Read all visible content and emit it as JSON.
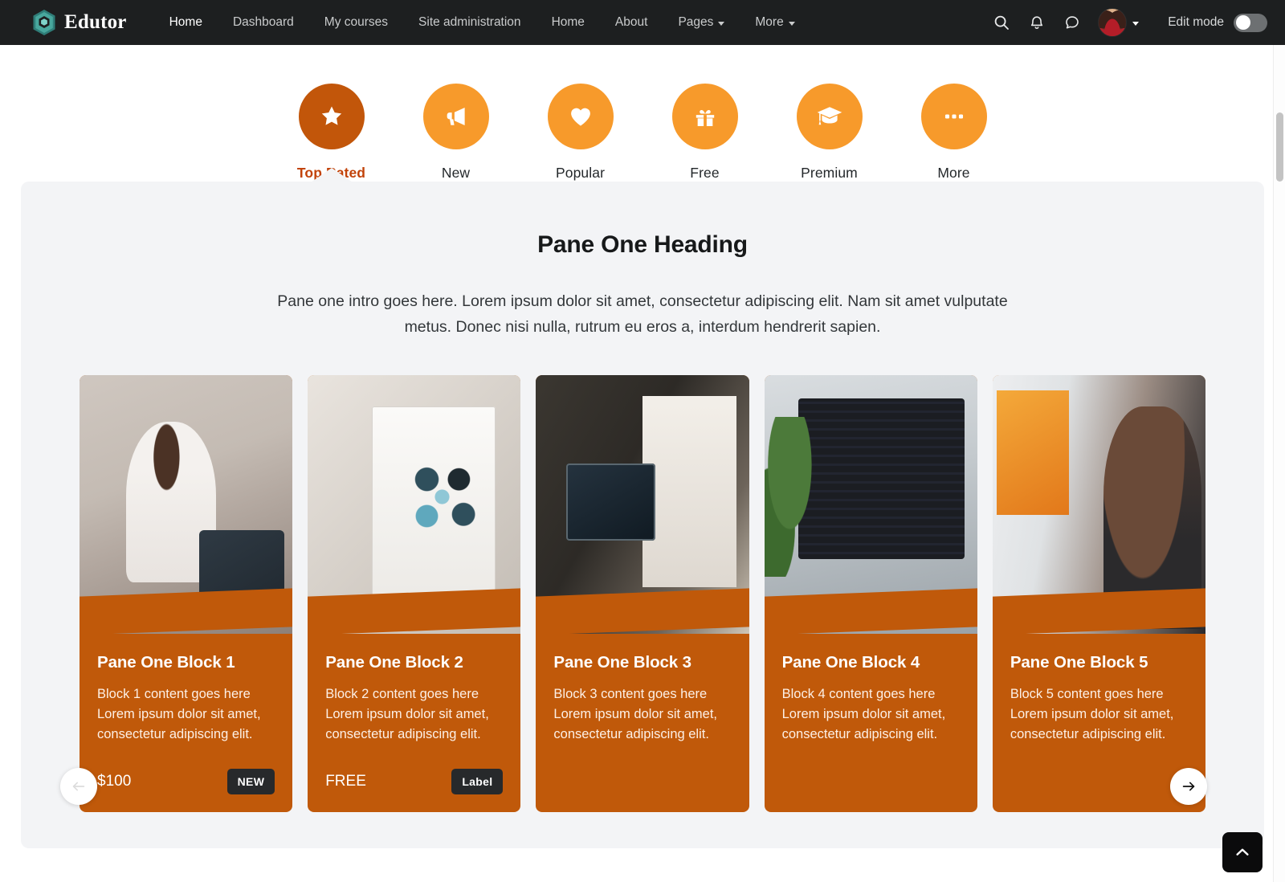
{
  "navbar": {
    "brand": {
      "name": "Edutor",
      "icon": "hexagon-cube-logo-icon"
    },
    "links": [
      {
        "label": "Home",
        "active": true,
        "caret": false
      },
      {
        "label": "Dashboard",
        "active": false,
        "caret": false
      },
      {
        "label": "My courses",
        "active": false,
        "caret": false
      },
      {
        "label": "Site administration",
        "active": false,
        "caret": false
      },
      {
        "label": "Home",
        "active": false,
        "caret": false
      },
      {
        "label": "About",
        "active": false,
        "caret": false
      },
      {
        "label": "Pages",
        "active": false,
        "caret": true
      },
      {
        "label": "More",
        "active": false,
        "caret": true
      }
    ],
    "icons": [
      {
        "name": "search-icon"
      },
      {
        "name": "bell-notification-icon"
      },
      {
        "name": "message-bubble-icon"
      }
    ],
    "avatar": {
      "name": "user-avatar",
      "caret": true
    },
    "edit_mode": {
      "label": "Edit mode",
      "enabled": false
    }
  },
  "categories": [
    {
      "label": "Top Rated",
      "icon": "star-icon",
      "active": true
    },
    {
      "label": "New",
      "icon": "megaphone-icon",
      "active": false
    },
    {
      "label": "Popular",
      "icon": "heart-icon",
      "active": false
    },
    {
      "label": "Free",
      "icon": "gift-icon",
      "active": false
    },
    {
      "label": "Premium",
      "icon": "graduation-cap-icon",
      "active": false
    },
    {
      "label": "More",
      "icon": "ellipsis-icon",
      "active": false
    }
  ],
  "pane": {
    "heading": "Pane One Heading",
    "intro": "Pane one intro goes here. Lorem ipsum dolor sit amet, consectetur adipiscing elit. Nam sit amet vulputate metus. Donec nisi nulla, rutrum eu eros a, interdum hendrerit sapien."
  },
  "cards": [
    {
      "title": "Pane One Block 1",
      "text": "Block 1 content goes here Lorem ipsum dolor sit amet, consectetur adipiscing elit.",
      "price": "$100",
      "badge": "NEW",
      "image_alt": "woman-reading-tablet-on-couch"
    },
    {
      "title": "Pane One Block 2",
      "text": "Block 2 content goes here Lorem ipsum dolor sit amet, consectetur adipiscing elit.",
      "price": "FREE",
      "badge": "Label",
      "image_alt": "open-book-with-diagram"
    },
    {
      "title": "Pane One Block 3",
      "text": "Block 3 content goes here Lorem ipsum dolor sit amet, consectetur adipiscing elit.",
      "price": "",
      "badge": "",
      "image_alt": "man-holding-tablet-by-easel"
    },
    {
      "title": "Pane One Block 4",
      "text": "Block 4 content goes here Lorem ipsum dolor sit amet, consectetur adipiscing elit.",
      "price": "",
      "badge": "",
      "image_alt": "hands-typing-on-laptop-with-code"
    },
    {
      "title": "Pane One Block 5",
      "text": "Block 5 content goes here Lorem ipsum dolor sit amet, consectetur adipiscing elit.",
      "price": "",
      "badge": "",
      "image_alt": "woman-with-sticky-notes-at-window"
    }
  ],
  "carousel": {
    "prev_icon": "arrow-left-icon",
    "next_icon": "arrow-right-icon"
  },
  "scroll_top": {
    "icon": "chevron-up-icon"
  },
  "colors": {
    "navbar_bg": "#1d1f20",
    "accent_orange": "#f79a2b",
    "accent_orange_dark": "#c2560a",
    "card_orange": "#c0590a",
    "pane_bg": "#f3f4f6",
    "badge_bg": "#27292b",
    "logo_teal": "#3f9e96"
  }
}
